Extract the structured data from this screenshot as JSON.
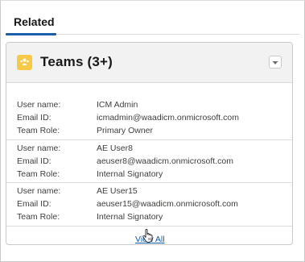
{
  "tabs": {
    "related": "Related"
  },
  "card": {
    "title": "Teams (3+)",
    "icon": "team-icon",
    "menu_icon": "chevron-down-icon",
    "accent": "#f7c948"
  },
  "records": [
    {
      "user_name_label": "User name:",
      "user_name": "ICM Admin",
      "email_label": "Email ID:",
      "email": "icmadmin@waadicm.onmicrosoft.com",
      "role_label": "Team Role:",
      "role": "Primary Owner"
    },
    {
      "user_name_label": "User name:",
      "user_name": "AE User8",
      "email_label": "Email ID:",
      "email": "aeuser8@waadicm.onmicrosoft.com",
      "role_label": "Team Role:",
      "role": "Internal Signatory"
    },
    {
      "user_name_label": "User name:",
      "user_name": "AE User15",
      "email_label": "Email ID:",
      "email": "aeuser15@waadicm.onmicrosoft.com",
      "role_label": "Team Role:",
      "role": "Internal Signatory"
    }
  ],
  "footer": {
    "view_all": "View All"
  },
  "colors": {
    "link": "#0b5cab",
    "tab_underline": "#1b5eab"
  }
}
